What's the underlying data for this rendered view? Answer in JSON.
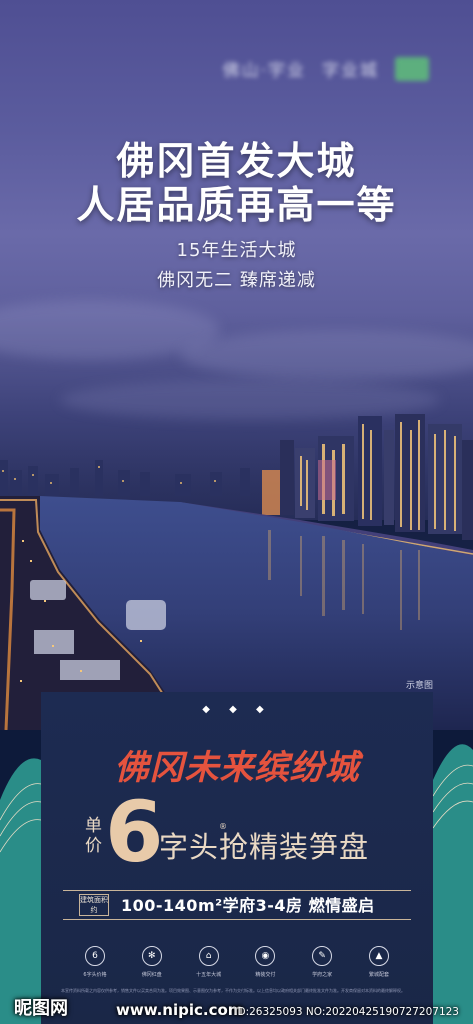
{
  "brand": {
    "name_left": "佛山·宇业",
    "name_right": "字业城"
  },
  "headline": {
    "line1": "佛冈首发大城",
    "line2": "人居品质再高一等"
  },
  "subhead": {
    "line1": "15年生活大城",
    "line2": "佛冈无二 臻席递减"
  },
  "image_note": "示意图",
  "panel": {
    "dots": "◆ ◆ ◆",
    "project_name": "佛冈未来缤纷城",
    "unit_price_label": "单价",
    "price_digit": "6",
    "price_text": "字头抢精装笋盘",
    "price_reg": "®",
    "spec_tag": "建筑面积约",
    "spec_text": "100-140m²学府3-4房  燃情盛启",
    "icons": [
      {
        "symbol": "6",
        "caption": "6字头价格",
        "icon": "price-icon"
      },
      {
        "symbol": "✻",
        "caption": "佛冈红盘",
        "icon": "snowflake-icon"
      },
      {
        "symbol": "⌂",
        "caption": "十五年大城",
        "icon": "building-icon"
      },
      {
        "symbol": "◉",
        "caption": "精装交付",
        "icon": "car-icon"
      },
      {
        "symbol": "✎",
        "caption": "学府之家",
        "icon": "pen-icon"
      },
      {
        "symbol": "▲",
        "caption": "繁城配套",
        "icon": "tower-icon"
      }
    ],
    "fine_print": "本宣传资料所载之内容仅供参考，销售文件以买卖合同为准。项目效果图、示意图仅为参考，不作为交付标准。以上信息均以政府相关部门最终批准文件为准。开发商保留对本资料的最终解释权。"
  },
  "watermark": {
    "logo": "昵图网",
    "url": "www.nipic.com",
    "id": "ID:26325093 NO:20220425190727207123"
  },
  "colors": {
    "project_red": "#e5533e",
    "gold": "#e8caa9",
    "panel_bg": "#1d2b52",
    "sky": "#5b5c9e"
  }
}
